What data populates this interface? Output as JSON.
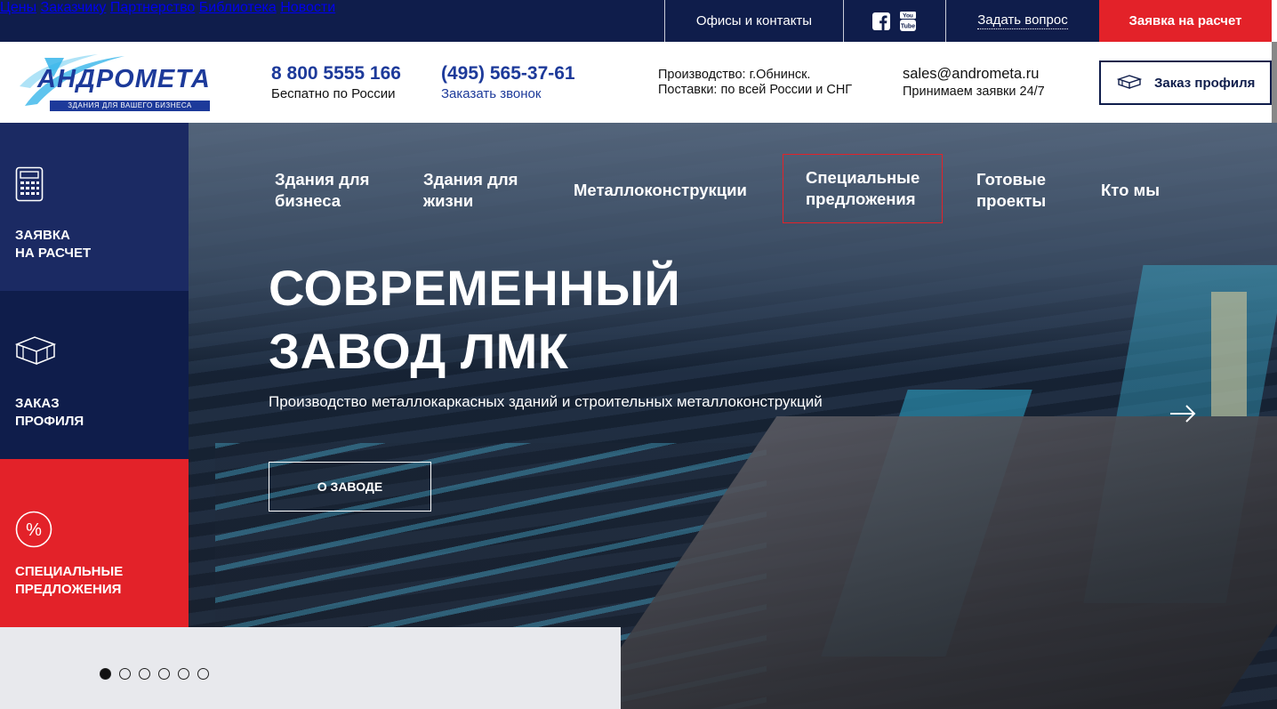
{
  "topnav": {
    "items": [
      "Цены",
      "Заказчику",
      "Партнерство",
      "Библиотека",
      "Новости"
    ],
    "offices": "Офисы и контакты",
    "social": [
      "facebook-icon",
      "youtube-icon"
    ],
    "ask": "Задать вопрос",
    "request": "Заявка на расчет"
  },
  "header": {
    "logo_text": "АНДРОМЕТА",
    "logo_tagline": "ЗДАНИЯ ДЛЯ ВАШЕГО БИЗНЕСА",
    "phone1": "8 800 5555 166",
    "phone1_note": "Беспатно по России",
    "phone2": "(495) 565-37-61",
    "phone2_note": "Заказать звонок",
    "production": "Производство: г.Обнинск.",
    "delivery": "Поставки: по всей России и СНГ",
    "email": "sales@andrometa.ru",
    "email_note": "Принимаем заявки 24/7",
    "profile_button": "Заказ профиля"
  },
  "hero": {
    "menu": [
      {
        "label": "Здания для\nбизнеса"
      },
      {
        "label": "Здания для\nжизни"
      },
      {
        "label": "Металлоконструкции"
      },
      {
        "label": "Специальные\nпредложения"
      },
      {
        "label": "Готовые\nпроекты"
      },
      {
        "label": "Кто мы"
      }
    ],
    "title_line1": "СОВРЕМЕННЫЙ",
    "title_line2": "ЗАВОД ЛМК",
    "subtitle": "Производство металлокаркасных зданий и строительных металлоконструкций",
    "button": "О ЗАВОДЕ"
  },
  "sidebar": [
    {
      "label": "ЗАЯВКА\nНА РАСЧЕТ",
      "icon": "calculator-icon"
    },
    {
      "label": "ЗАКАЗ\nПРОФИЛЯ",
      "icon": "profile-icon"
    },
    {
      "label": "СПЕЦИАЛЬНЫЕ\nПРЕДЛОЖЕНИЯ",
      "icon": "percent-icon"
    }
  ],
  "slider": {
    "count": 6,
    "active": 1
  },
  "colors": {
    "navy": "#0f1d4b",
    "red": "#e32229",
    "brand_blue": "#1d3a9a"
  }
}
